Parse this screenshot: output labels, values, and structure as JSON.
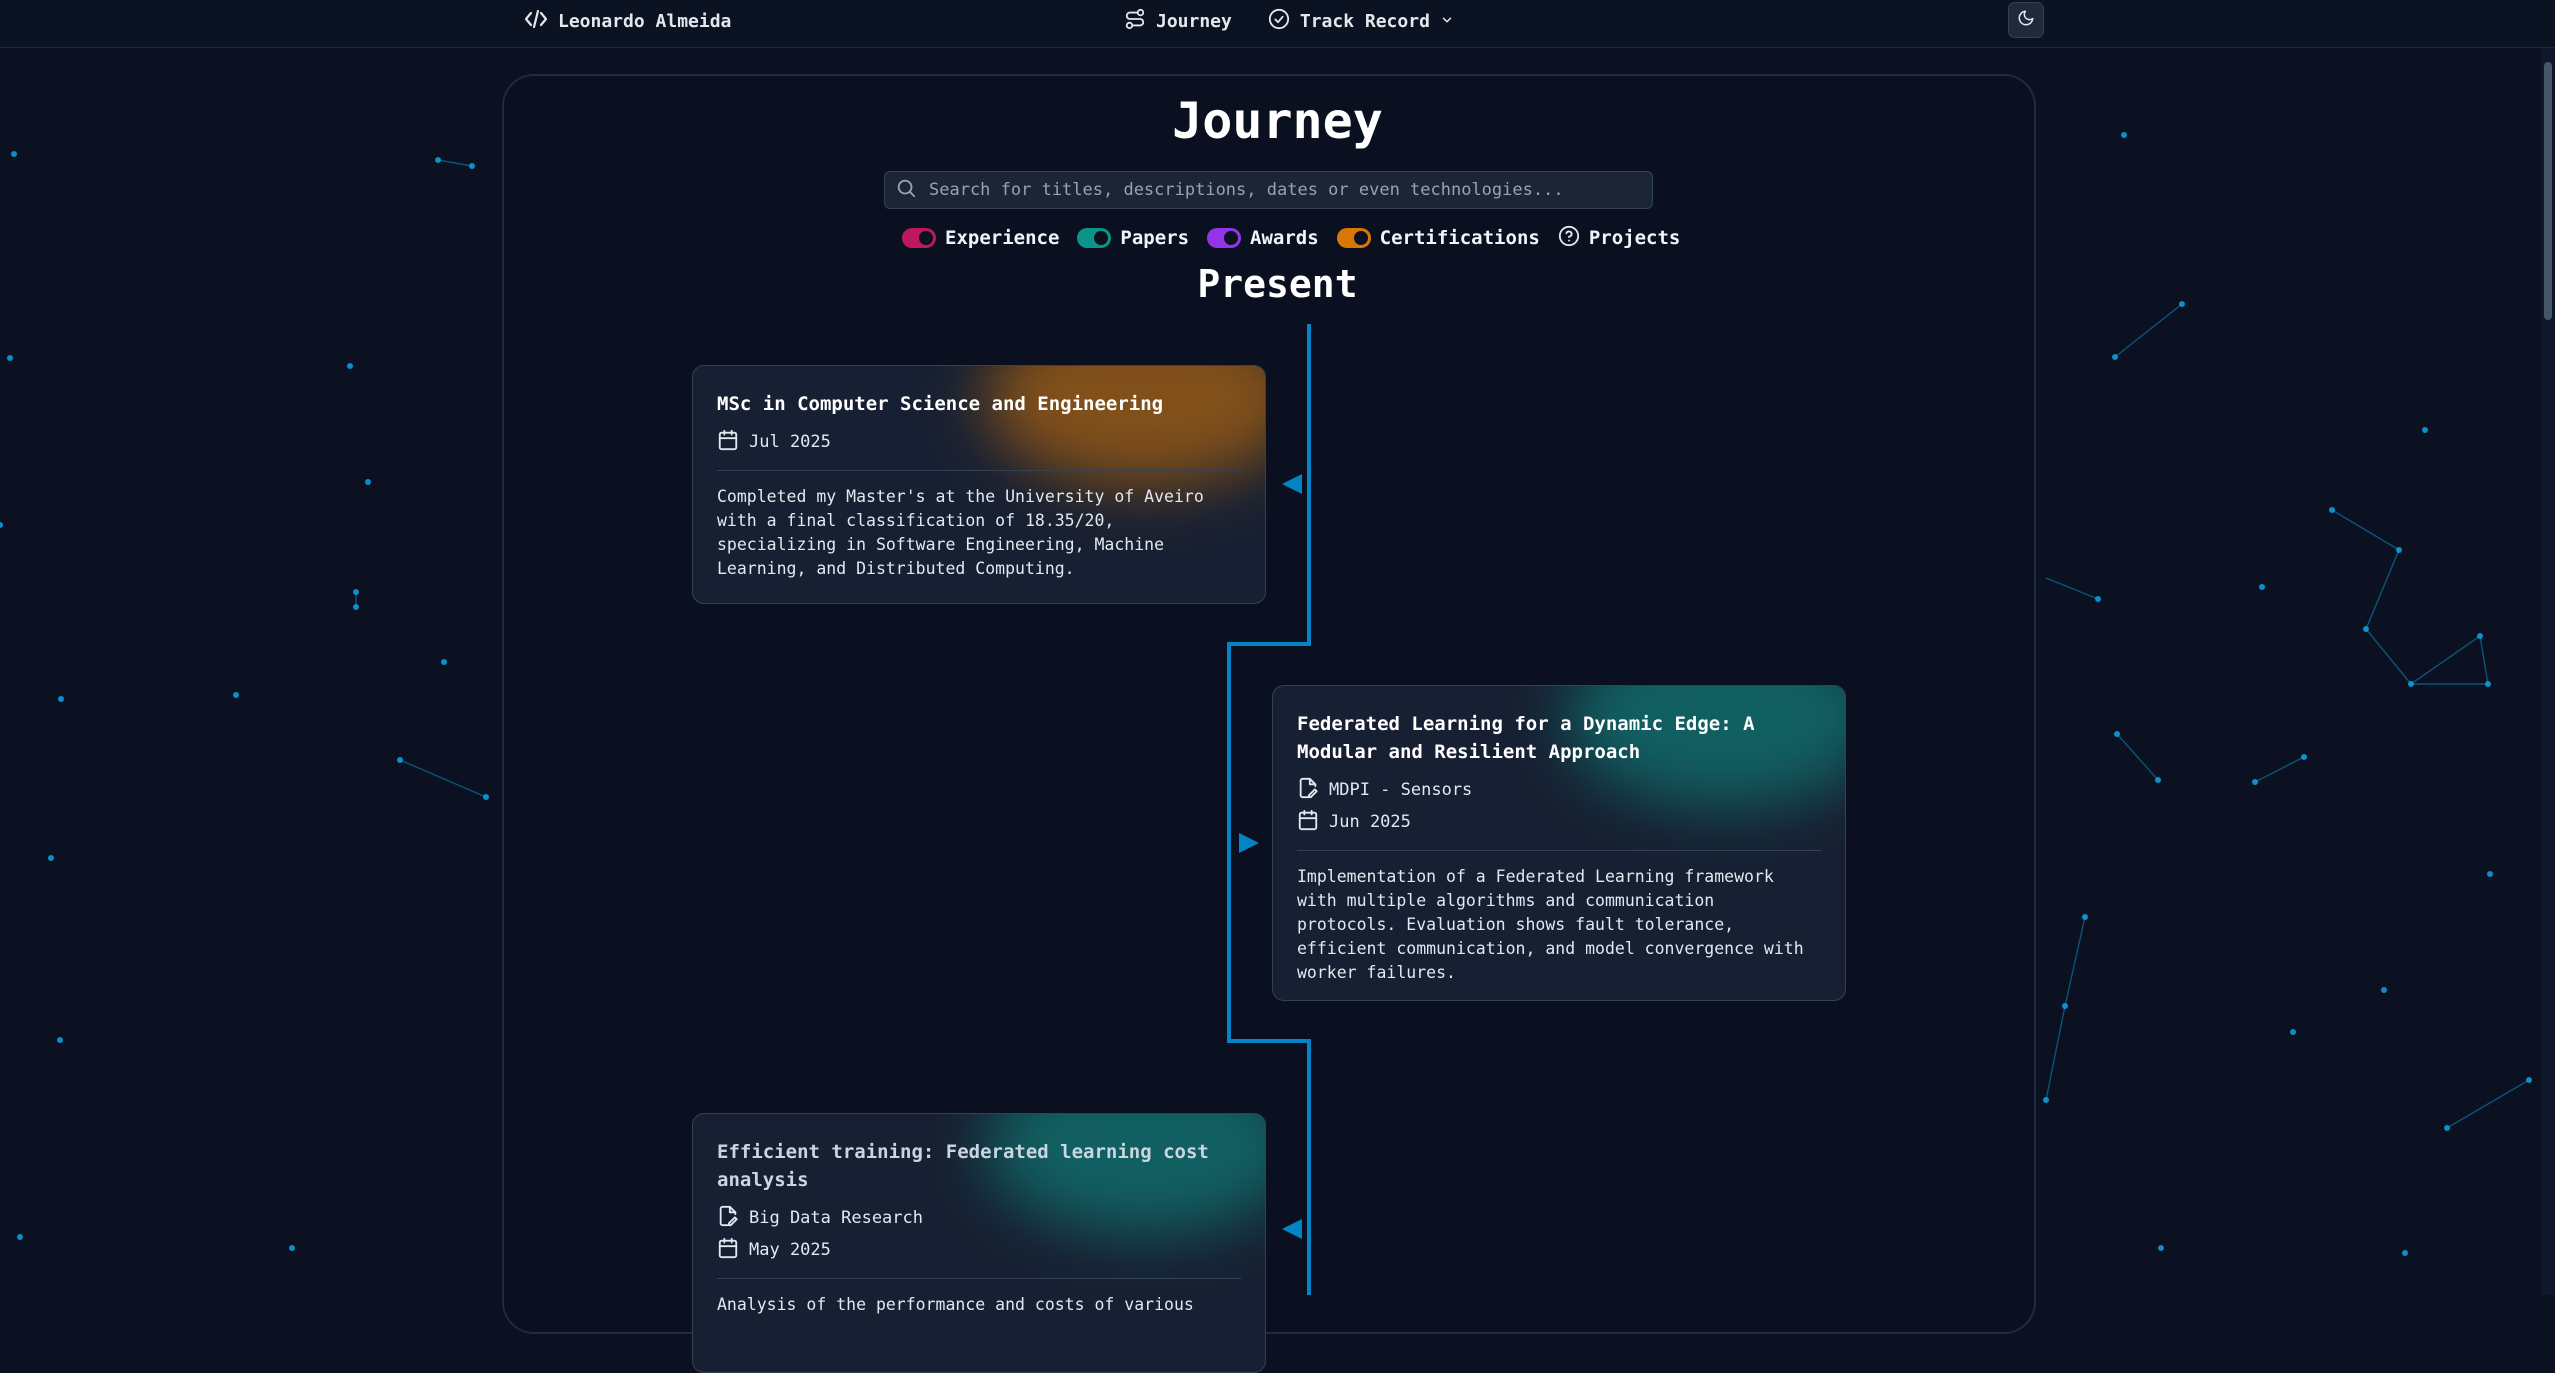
{
  "nav": {
    "brand": "Leonardo Almeida",
    "journey": "Journey",
    "track_record": "Track Record"
  },
  "page": {
    "title": "Journey",
    "search_placeholder": "Search for titles, descriptions, dates or even technologies...",
    "section_label": "Present"
  },
  "filters": [
    {
      "label": "Experience",
      "color": "#be185d",
      "type": "toggle",
      "on": true
    },
    {
      "label": "Papers",
      "color": "#0d9488",
      "type": "toggle",
      "on": true
    },
    {
      "label": "Awards",
      "color": "#9333ea",
      "type": "toggle",
      "on": true
    },
    {
      "label": "Certifications",
      "color": "#d97706",
      "type": "toggle",
      "on": true
    },
    {
      "label": "Projects",
      "type": "help-icon"
    }
  ],
  "timeline": {
    "accent": "#0284c7",
    "items": [
      {
        "title": "MSc in Computer Science and Engineering",
        "date": "Jul 2025",
        "description": "Completed my Master's at the University of Aveiro with a final classification of 18.35/20, specializing in Software Engineering, Machine Learning, and Distributed Computing.",
        "glow": "#d97706"
      },
      {
        "title": "Federated Learning for a Dynamic Edge: A Modular and Resilient Approach",
        "venue": "MDPI - Sensors",
        "date": "Jun 2025",
        "description": "Implementation of a Federated Learning framework with multiple algorithms and communication protocols. Evaluation shows fault tolerance, efficient communication, and model convergence with worker failures.",
        "glow": "#0d9488"
      },
      {
        "title": "Efficient training: Federated learning cost analysis",
        "venue": "Big Data Research",
        "date": "May 2025",
        "description": "Analysis of the performance and costs of various",
        "glow": "#0d9488"
      }
    ]
  },
  "colors": {
    "background": "#0b1120",
    "particles": "#0ea5e9"
  }
}
